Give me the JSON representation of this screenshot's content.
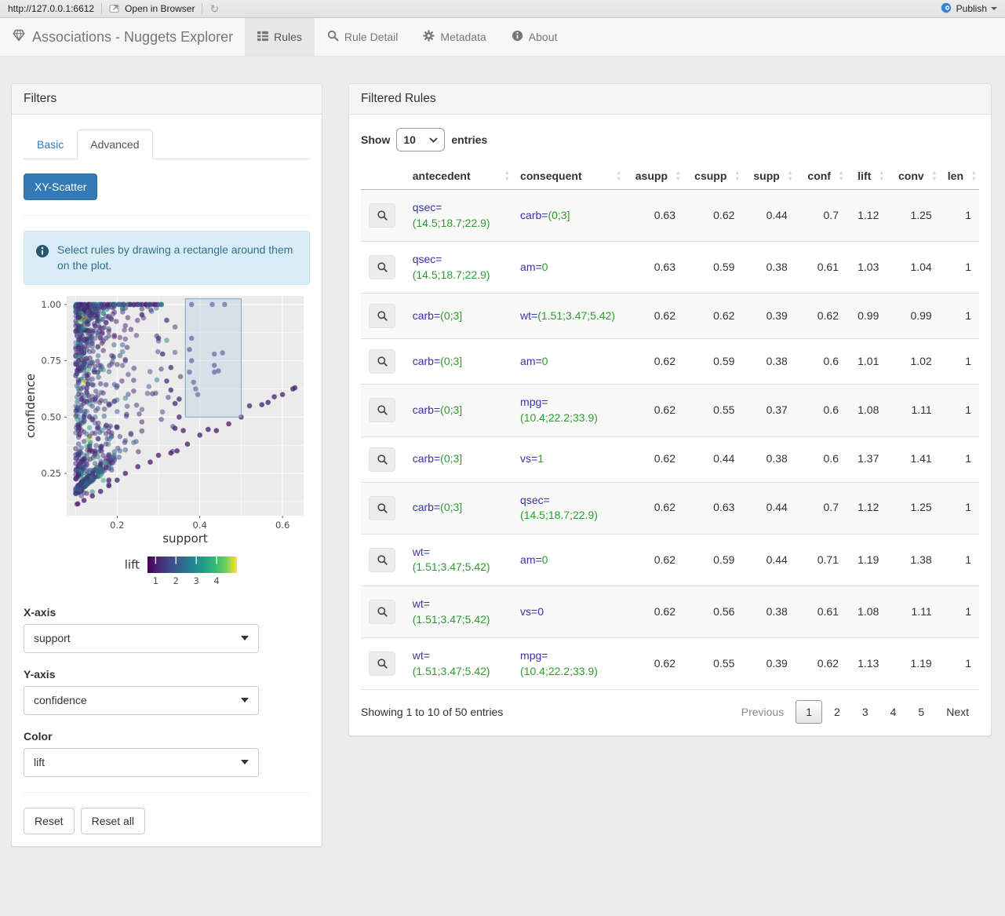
{
  "toolbar": {
    "url": "http://127.0.0.1:6612",
    "open_in_browser": "Open in Browser",
    "refresh_glyph": "↻",
    "publish": "Publish"
  },
  "navbar": {
    "brand": "Associations - Nuggets Explorer",
    "tabs": [
      {
        "label": "Rules",
        "icon": "table-icon",
        "active": true
      },
      {
        "label": "Rule Detail",
        "icon": "search-icon",
        "active": false
      },
      {
        "label": "Metadata",
        "icon": "gear-icon",
        "active": false
      },
      {
        "label": "About",
        "icon": "info-icon",
        "active": false
      }
    ]
  },
  "filters": {
    "title": "Filters",
    "tabs": [
      "Basic",
      "Advanced"
    ],
    "active_tab": "Advanced",
    "scatter_button": "XY-Scatter",
    "info_text": "Select rules by drawing a rectangle around them on the plot.",
    "x_axis": {
      "label": "X-axis",
      "value": "support"
    },
    "y_axis": {
      "label": "Y-axis",
      "value": "confidence"
    },
    "color": {
      "label": "Color",
      "value": "lift"
    },
    "reset": "Reset",
    "reset_all": "Reset all"
  },
  "chart_data": {
    "type": "scatter",
    "xlabel": "support",
    "ylabel": "confidence",
    "xlim": [
      0.078,
      0.651
    ],
    "ylim": [
      0.062,
      1.038
    ],
    "x_ticks": [
      {
        "v": 0.2,
        "label": "0.2"
      },
      {
        "v": 0.4,
        "label": "0.4"
      },
      {
        "v": 0.6,
        "label": "0.6"
      }
    ],
    "y_ticks": [
      {
        "v": 0.25,
        "label": "0.25"
      },
      {
        "v": 0.5,
        "label": "0.50"
      },
      {
        "v": 0.75,
        "label": "0.75"
      },
      {
        "v": 1.0,
        "label": "1.00"
      }
    ],
    "x_minor": [
      0.1,
      0.3,
      0.5
    ],
    "y_minor": [
      0.125,
      0.375,
      0.625,
      0.875
    ],
    "panel_bg": "#ebebeb",
    "grid_color": "#ffffff",
    "brush": {
      "x0": 0.365,
      "x1": 0.5,
      "y0": 0.5,
      "y1": 1.025,
      "fill": "#b9cfe7",
      "fill_opacity": 0.4,
      "stroke": "#7da3c4"
    },
    "color_legend": {
      "label": "lift",
      "domain": [
        0.6,
        5.0
      ],
      "ticks": [
        {
          "v": 1,
          "label": "1"
        },
        {
          "v": 2,
          "label": "2"
        },
        {
          "v": 3,
          "label": "3"
        },
        {
          "v": 4,
          "label": "4"
        }
      ],
      "palette": "viridis"
    },
    "palette_stops": [
      [
        0,
        "#440154"
      ],
      [
        0.125,
        "#482878"
      ],
      [
        0.25,
        "#3e4a89"
      ],
      [
        0.375,
        "#31688e"
      ],
      [
        0.5,
        "#26828e"
      ],
      [
        0.625,
        "#1f9e89"
      ],
      [
        0.75,
        "#35b779"
      ],
      [
        0.875,
        "#6ece58"
      ],
      [
        1,
        "#fde725"
      ]
    ],
    "points_generator": {
      "seed": 1337,
      "count": 900,
      "x_min": 0.1,
      "x_exp_mean": 0.045,
      "x_max": 0.52,
      "top_row_count": 40,
      "top_row_x_min": 0.1,
      "top_row_x_max": 0.31,
      "lift_base": 0.9,
      "lift_exp_mean": 0.6,
      "ray_supports": [
        0.63,
        0.62,
        0.59,
        0.56,
        0.55,
        0.44,
        0.38
      ],
      "ray_prob": 0.3
    },
    "sample_points": [
      [
        0.38,
        1.0,
        1.2
      ],
      [
        0.43,
        1.0,
        1.3
      ],
      [
        0.46,
        1.0,
        1.3
      ],
      [
        0.38,
        0.85,
        1.1
      ],
      [
        0.375,
        0.8,
        1.1
      ],
      [
        0.38,
        0.75,
        1.1
      ],
      [
        0.375,
        0.7,
        1.2
      ],
      [
        0.385,
        0.655,
        1.3
      ],
      [
        0.39,
        0.625,
        1.4
      ],
      [
        0.395,
        0.6,
        1.5
      ],
      [
        0.435,
        0.78,
        1.25
      ],
      [
        0.455,
        0.785,
        1.3
      ],
      [
        0.435,
        0.73,
        1.2
      ],
      [
        0.435,
        0.7,
        1.2
      ],
      [
        0.445,
        0.705,
        1.15
      ],
      [
        0.5,
        0.5,
        1.0
      ],
      [
        0.52,
        0.55,
        1.05
      ],
      [
        0.55,
        0.555,
        1.0
      ],
      [
        0.565,
        0.565,
        1.0
      ],
      [
        0.58,
        0.59,
        1.0
      ],
      [
        0.6,
        0.6,
        1.0
      ],
      [
        0.625,
        0.625,
        1.0
      ],
      [
        0.63,
        0.63,
        1.05
      ],
      [
        0.47,
        0.47,
        0.95
      ],
      [
        0.44,
        0.44,
        0.95
      ],
      [
        0.42,
        0.445,
        1.0
      ],
      [
        0.4,
        0.42,
        1.0
      ],
      [
        0.37,
        0.38,
        0.95
      ],
      [
        0.345,
        0.35,
        0.95
      ],
      [
        0.33,
        0.34,
        0.95
      ],
      [
        0.3,
        0.33,
        1.0
      ],
      [
        0.28,
        0.3,
        0.95
      ],
      [
        0.25,
        0.28,
        1.0
      ],
      [
        0.22,
        0.25,
        1.0
      ],
      [
        0.2,
        0.22,
        1.0
      ],
      [
        0.18,
        0.195,
        0.95
      ],
      [
        0.16,
        0.17,
        0.95
      ],
      [
        0.14,
        0.15,
        0.95
      ],
      [
        0.12,
        0.13,
        0.95
      ],
      [
        0.105,
        0.115,
        0.95
      ],
      [
        0.33,
        0.62,
        1.2
      ],
      [
        0.34,
        0.56,
        1.15
      ],
      [
        0.35,
        0.58,
        1.2
      ],
      [
        0.32,
        0.66,
        1.25
      ],
      [
        0.33,
        0.72,
        1.3
      ],
      [
        0.31,
        0.78,
        1.3
      ],
      [
        0.3,
        0.85,
        1.4
      ],
      [
        0.32,
        0.93,
        1.5
      ],
      [
        0.35,
        0.5,
        1.1
      ],
      [
        0.34,
        0.45,
        1.05
      ],
      [
        0.36,
        0.44,
        1.0
      ]
    ]
  },
  "table": {
    "title": "Filtered Rules",
    "show_label": "Show",
    "entries_label": "entries",
    "page_length": "10",
    "columns": [
      "antecedent",
      "consequent",
      "asupp",
      "csupp",
      "supp",
      "conf",
      "lift",
      "conv",
      "len"
    ],
    "rows": [
      {
        "antecedent": [
          [
            "qsec=",
            "attr"
          ],
          [
            "(14.5;18.7;22.9)",
            "val"
          ]
        ],
        "consequent": [
          [
            "carb=",
            "attr"
          ],
          [
            "(0;3]",
            "val"
          ]
        ],
        "values": [
          "0.63",
          "0.62",
          "0.44",
          "0.7",
          "1.12",
          "1.25",
          "1"
        ]
      },
      {
        "antecedent": [
          [
            "qsec=",
            "attr"
          ],
          [
            "(14.5;18.7;22.9)",
            "val"
          ]
        ],
        "consequent": [
          [
            "am=",
            "attr"
          ],
          [
            "0",
            "val"
          ]
        ],
        "values": [
          "0.63",
          "0.59",
          "0.38",
          "0.61",
          "1.03",
          "1.04",
          "1"
        ]
      },
      {
        "antecedent": [
          [
            "carb=",
            "attr"
          ],
          [
            "(0;3]",
            "val"
          ]
        ],
        "consequent": [
          [
            "wt=",
            "attr"
          ],
          [
            "(1.51;3.47;5.42)",
            "val"
          ]
        ],
        "values": [
          "0.62",
          "0.62",
          "0.39",
          "0.62",
          "0.99",
          "0.99",
          "1"
        ]
      },
      {
        "antecedent": [
          [
            "carb=",
            "attr"
          ],
          [
            "(0;3]",
            "val"
          ]
        ],
        "consequent": [
          [
            "am=",
            "attr"
          ],
          [
            "0",
            "val"
          ]
        ],
        "values": [
          "0.62",
          "0.59",
          "0.38",
          "0.6",
          "1.01",
          "1.02",
          "1"
        ]
      },
      {
        "antecedent": [
          [
            "carb=",
            "attr"
          ],
          [
            "(0;3]",
            "val"
          ]
        ],
        "consequent": [
          [
            "mpg=",
            "attr"
          ],
          [
            "(10.4;22.2;33.9)",
            "val"
          ]
        ],
        "values": [
          "0.62",
          "0.55",
          "0.37",
          "0.6",
          "1.08",
          "1.11",
          "1"
        ]
      },
      {
        "antecedent": [
          [
            "carb=",
            "attr"
          ],
          [
            "(0;3]",
            "val"
          ]
        ],
        "consequent": [
          [
            "vs=",
            "attr"
          ],
          [
            "1",
            "val"
          ]
        ],
        "values": [
          "0.62",
          "0.44",
          "0.38",
          "0.6",
          "1.37",
          "1.41",
          "1"
        ]
      },
      {
        "antecedent": [
          [
            "carb=",
            "attr"
          ],
          [
            "(0;3]",
            "val"
          ]
        ],
        "consequent": [
          [
            "qsec=",
            "attr"
          ],
          [
            "(14.5;18.7;22.9)",
            "val"
          ]
        ],
        "values": [
          "0.62",
          "0.63",
          "0.44",
          "0.7",
          "1.12",
          "1.25",
          "1"
        ]
      },
      {
        "antecedent": [
          [
            "wt=",
            "attr"
          ],
          [
            "(1.51;3.47;5.42)",
            "val"
          ]
        ],
        "consequent": [
          [
            "am=",
            "attr"
          ],
          [
            "0",
            "val"
          ]
        ],
        "values": [
          "0.62",
          "0.59",
          "0.44",
          "0.71",
          "1.19",
          "1.38",
          "1"
        ]
      },
      {
        "antecedent": [
          [
            "wt=",
            "attr"
          ],
          [
            "(1.51;3.47;5.42)",
            "val"
          ]
        ],
        "consequent": [
          [
            "vs=",
            "attr"
          ],
          [
            "0",
            "attr"
          ]
        ],
        "values": [
          "0.62",
          "0.56",
          "0.38",
          "0.61",
          "1.08",
          "1.11",
          "1"
        ]
      },
      {
        "antecedent": [
          [
            "wt=",
            "attr"
          ],
          [
            "(1.51;3.47;5.42)",
            "val"
          ]
        ],
        "consequent": [
          [
            "mpg=",
            "attr"
          ],
          [
            "(10.4;22.2;33.9)",
            "val"
          ]
        ],
        "values": [
          "0.62",
          "0.55",
          "0.39",
          "0.62",
          "1.13",
          "1.19",
          "1"
        ]
      }
    ],
    "info": "Showing 1 to 10 of 50 entries",
    "pagination": {
      "previous": "Previous",
      "pages": [
        "1",
        "2",
        "3",
        "4",
        "5"
      ],
      "active": "1",
      "next": "Next"
    }
  },
  "colors": {
    "accent": "#337ab7",
    "rule_attr": "#3535a8",
    "rule_value": "#2e9b2e",
    "alert_bg": "#d9edf7",
    "alert_text": "#31708f",
    "alert_icon": "#27586e",
    "publish_blue": "#2e84d5"
  }
}
